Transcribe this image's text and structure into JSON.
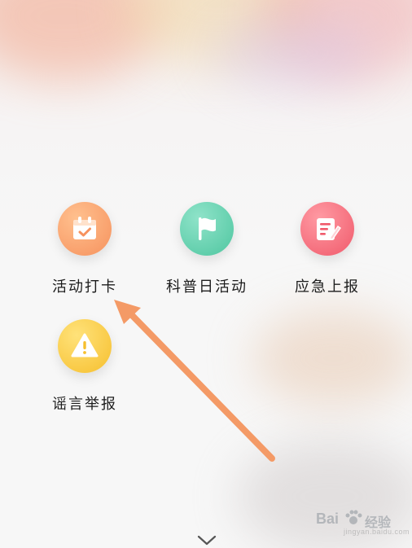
{
  "menu": {
    "items": [
      {
        "label": "活动打卡",
        "icon": "calendar-check-icon",
        "color": "#f7a06b"
      },
      {
        "label": "科普日活动",
        "icon": "flag-icon",
        "color": "#5fcfae"
      },
      {
        "label": "应急上报",
        "icon": "report-edit-icon",
        "color": "#f36b7a"
      },
      {
        "label": "谣言举报",
        "icon": "warning-icon",
        "color": "#f8cc45"
      }
    ]
  },
  "annotation": {
    "arrow_color": "#f49a66"
  },
  "footer": {
    "expand_icon": "chevron-down-icon"
  },
  "watermark": {
    "brand": "Bai",
    "brand_cn": "经验",
    "url": "jingyan.baidu.com"
  }
}
